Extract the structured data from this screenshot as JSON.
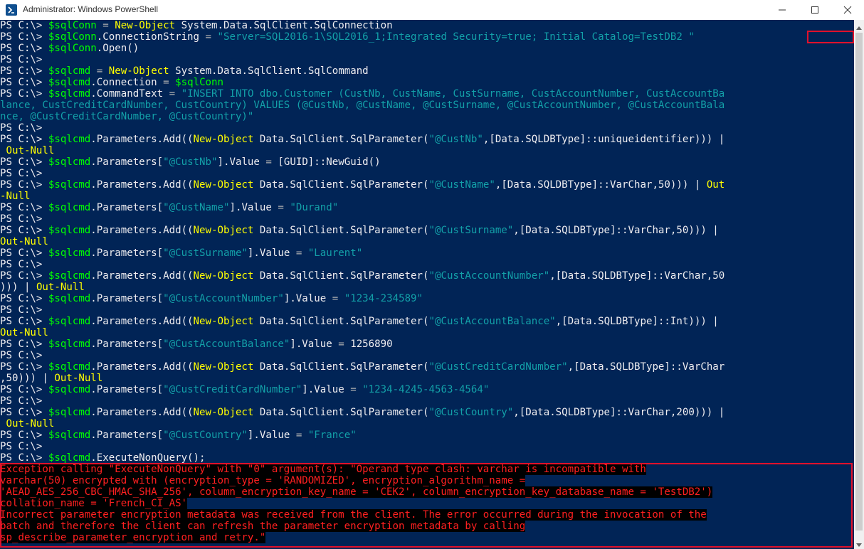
{
  "window": {
    "title": "Administrator: Windows PowerShell",
    "icons": {
      "app": "powershell-icon",
      "minimize": "minimize-icon",
      "maximize": "maximize-icon",
      "close": "close-icon"
    },
    "colors": {
      "console_bg": "#012456",
      "default_text": "#eeedf0",
      "variable": "#00ff00",
      "command": "#ffff00",
      "string": "#13a0a8",
      "error_text": "#ff2020",
      "error_bg": "#000000",
      "highlight_border": "#e0112b"
    }
  },
  "console": {
    "lines": [
      [
        [
          "prompt",
          "PS C:\\> "
        ],
        [
          "var",
          "$sqlConn"
        ],
        [
          "text",
          " "
        ],
        [
          "op",
          "="
        ],
        [
          "text",
          " "
        ],
        [
          "cmd",
          "New-Object"
        ],
        [
          "text",
          " System.Data.SqlClient.SqlConnection"
        ]
      ],
      [
        [
          "prompt",
          "PS C:\\> "
        ],
        [
          "var",
          "$sqlConn"
        ],
        [
          "text",
          ".ConnectionString "
        ],
        [
          "op",
          "="
        ],
        [
          "text",
          " "
        ],
        [
          "str",
          "\"Server=SQL2016-1\\SQL2016_1;Integrated Security=true; Initial Catalog=TestDB2 \""
        ]
      ],
      [
        [
          "prompt",
          "PS C:\\> "
        ],
        [
          "var",
          "$sqlConn"
        ],
        [
          "text",
          ".Open()"
        ]
      ],
      [
        [
          "prompt",
          "PS C:\\>"
        ]
      ],
      [
        [
          "prompt",
          "PS C:\\> "
        ],
        [
          "var",
          "$sqlcmd"
        ],
        [
          "text",
          " "
        ],
        [
          "op",
          "="
        ],
        [
          "text",
          " "
        ],
        [
          "cmd",
          "New-Object"
        ],
        [
          "text",
          " System.Data.SqlClient.SqlCommand"
        ]
      ],
      [
        [
          "prompt",
          "PS C:\\> "
        ],
        [
          "var",
          "$sqlcmd"
        ],
        [
          "text",
          ".Connection "
        ],
        [
          "op",
          "="
        ],
        [
          "text",
          " "
        ],
        [
          "var",
          "$sqlConn"
        ]
      ],
      [
        [
          "prompt",
          "PS C:\\> "
        ],
        [
          "var",
          "$sqlcmd"
        ],
        [
          "text",
          ".CommandText "
        ],
        [
          "op",
          "="
        ],
        [
          "text",
          " "
        ],
        [
          "str",
          "\"INSERT INTO dbo.Customer (CustNb, CustName, CustSurname, CustAccountNumber, CustAccountBa"
        ]
      ],
      [
        [
          "str",
          "lance, CustCreditCardNumber, CustCountry) VALUES (@CustNb, @CustName, @CustSurname, @CustAccountNumber, @CustAccountBala"
        ]
      ],
      [
        [
          "str",
          "nce, @CustCreditCardNumber, @CustCountry)\""
        ]
      ],
      [
        [
          "prompt",
          "PS C:\\>"
        ]
      ],
      [
        [
          "prompt",
          "PS C:\\> "
        ],
        [
          "var",
          "$sqlcmd"
        ],
        [
          "text",
          ".Parameters.Add(("
        ],
        [
          "cmd",
          "New-Object"
        ],
        [
          "text",
          " Data.SqlClient.SqlParameter("
        ],
        [
          "str",
          "\"@CustNb\""
        ],
        [
          "text",
          ",[Data.SQLDBType]::uniqueidentifier))) |"
        ]
      ],
      [
        [
          "text",
          " "
        ],
        [
          "cmd",
          "Out-Null"
        ]
      ],
      [
        [
          "prompt",
          "PS C:\\> "
        ],
        [
          "var",
          "$sqlcmd"
        ],
        [
          "text",
          ".Parameters["
        ],
        [
          "str",
          "\"@CustNb\""
        ],
        [
          "text",
          "].Value "
        ],
        [
          "op",
          "="
        ],
        [
          "text",
          " [GUID]::NewGuid()"
        ]
      ],
      [
        [
          "prompt",
          "PS C:\\>"
        ]
      ],
      [
        [
          "prompt",
          "PS C:\\> "
        ],
        [
          "var",
          "$sqlcmd"
        ],
        [
          "text",
          ".Parameters.Add(("
        ],
        [
          "cmd",
          "New-Object"
        ],
        [
          "text",
          " Data.SqlClient.SqlParameter("
        ],
        [
          "str",
          "\"@CustName\""
        ],
        [
          "text",
          ",[Data.SQLDBType]::VarChar,50))) | "
        ],
        [
          "cmd",
          "Out"
        ]
      ],
      [
        [
          "cmd",
          "-Null"
        ]
      ],
      [
        [
          "prompt",
          "PS C:\\> "
        ],
        [
          "var",
          "$sqlcmd"
        ],
        [
          "text",
          ".Parameters["
        ],
        [
          "str",
          "\"@CustName\""
        ],
        [
          "text",
          "].Value "
        ],
        [
          "op",
          "="
        ],
        [
          "text",
          " "
        ],
        [
          "str",
          "\"Durand\""
        ]
      ],
      [
        [
          "prompt",
          "PS C:\\>"
        ]
      ],
      [
        [
          "prompt",
          "PS C:\\> "
        ],
        [
          "var",
          "$sqlcmd"
        ],
        [
          "text",
          ".Parameters.Add(("
        ],
        [
          "cmd",
          "New-Object"
        ],
        [
          "text",
          " Data.SqlClient.SqlParameter("
        ],
        [
          "str",
          "\"@CustSurname\""
        ],
        [
          "text",
          ",[Data.SQLDBType]::VarChar,50))) |"
        ]
      ],
      [
        [
          "cmd",
          "Out-Null"
        ]
      ],
      [
        [
          "prompt",
          "PS C:\\> "
        ],
        [
          "var",
          "$sqlcmd"
        ],
        [
          "text",
          ".Parameters["
        ],
        [
          "str",
          "\"@CustSurname\""
        ],
        [
          "text",
          "].Value "
        ],
        [
          "op",
          "="
        ],
        [
          "text",
          " "
        ],
        [
          "str",
          "\"Laurent\""
        ]
      ],
      [
        [
          "prompt",
          "PS C:\\>"
        ]
      ],
      [
        [
          "prompt",
          "PS C:\\> "
        ],
        [
          "var",
          "$sqlcmd"
        ],
        [
          "text",
          ".Parameters.Add(("
        ],
        [
          "cmd",
          "New-Object"
        ],
        [
          "text",
          " Data.SqlClient.SqlParameter("
        ],
        [
          "str",
          "\"@CustAccountNumber\""
        ],
        [
          "text",
          ",[Data.SQLDBType]::VarChar,50"
        ]
      ],
      [
        [
          "text",
          ")))"
        ],
        [
          "text",
          " | "
        ],
        [
          "cmd",
          "Out-Null"
        ]
      ],
      [
        [
          "prompt",
          "PS C:\\> "
        ],
        [
          "var",
          "$sqlcmd"
        ],
        [
          "text",
          ".Parameters["
        ],
        [
          "str",
          "\"@CustAccountNumber\""
        ],
        [
          "text",
          "].Value "
        ],
        [
          "op",
          "="
        ],
        [
          "text",
          " "
        ],
        [
          "str",
          "\"1234-234589\""
        ]
      ],
      [
        [
          "prompt",
          "PS C:\\>"
        ]
      ],
      [
        [
          "prompt",
          "PS C:\\> "
        ],
        [
          "var",
          "$sqlcmd"
        ],
        [
          "text",
          ".Parameters.Add(("
        ],
        [
          "cmd",
          "New-Object"
        ],
        [
          "text",
          " Data.SqlClient.SqlParameter("
        ],
        [
          "str",
          "\"@CustAccountBalance\""
        ],
        [
          "text",
          ",[Data.SQLDBType]::Int))) |"
        ]
      ],
      [
        [
          "cmd",
          "Out-Null"
        ]
      ],
      [
        [
          "prompt",
          "PS C:\\> "
        ],
        [
          "var",
          "$sqlcmd"
        ],
        [
          "text",
          ".Parameters["
        ],
        [
          "str",
          "\"@CustAccountBalance\""
        ],
        [
          "text",
          "].Value "
        ],
        [
          "op",
          "="
        ],
        [
          "text",
          " 1256890"
        ]
      ],
      [
        [
          "prompt",
          "PS C:\\>"
        ]
      ],
      [
        [
          "prompt",
          "PS C:\\> "
        ],
        [
          "var",
          "$sqlcmd"
        ],
        [
          "text",
          ".Parameters.Add(("
        ],
        [
          "cmd",
          "New-Object"
        ],
        [
          "text",
          " Data.SqlClient.SqlParameter("
        ],
        [
          "str",
          "\"@CustCreditCardNumber\""
        ],
        [
          "text",
          ",[Data.SQLDBType]::VarChar"
        ]
      ],
      [
        [
          "text",
          ",50)))"
        ],
        [
          "text",
          " | "
        ],
        [
          "cmd",
          "Out-Null"
        ]
      ],
      [
        [
          "prompt",
          "PS C:\\> "
        ],
        [
          "var",
          "$sqlcmd"
        ],
        [
          "text",
          ".Parameters["
        ],
        [
          "str",
          "\"@CustCreditCardNumber\""
        ],
        [
          "text",
          "].Value "
        ],
        [
          "op",
          "="
        ],
        [
          "text",
          " "
        ],
        [
          "str",
          "\"1234-4245-4563-4564\""
        ]
      ],
      [
        [
          "prompt",
          "PS C:\\>"
        ]
      ],
      [
        [
          "prompt",
          "PS C:\\> "
        ],
        [
          "var",
          "$sqlcmd"
        ],
        [
          "text",
          ".Parameters.Add(("
        ],
        [
          "cmd",
          "New-Object"
        ],
        [
          "text",
          " Data.SqlClient.SqlParameter("
        ],
        [
          "str",
          "\"@CustCountry\""
        ],
        [
          "text",
          ",[Data.SQLDBType]::VarChar,200))) |"
        ]
      ],
      [
        [
          "text",
          " "
        ],
        [
          "cmd",
          "Out-Null"
        ]
      ],
      [
        [
          "prompt",
          "PS C:\\> "
        ],
        [
          "var",
          "$sqlcmd"
        ],
        [
          "text",
          ".Parameters["
        ],
        [
          "str",
          "\"@CustCountry\""
        ],
        [
          "text",
          "].Value "
        ],
        [
          "op",
          "="
        ],
        [
          "text",
          " "
        ],
        [
          "str",
          "\"France\""
        ]
      ],
      [
        [
          "prompt",
          "PS C:\\>"
        ]
      ],
      [
        [
          "prompt",
          "PS C:\\> "
        ],
        [
          "var",
          "$sqlcmd"
        ],
        [
          "text",
          ".ExecuteNonQuery();"
        ]
      ],
      [
        [
          "err",
          "Exception calling \"ExecuteNonQuery\" with \"0\" argument(s): \"Operand type clash: varchar is incompatible with"
        ]
      ],
      [
        [
          "err",
          "varchar(50) encrypted with (encryption_type = 'RANDOMIZED', encryption_algorithm_name ="
        ]
      ],
      [
        [
          "err",
          "'AEAD_AES_256_CBC_HMAC_SHA_256', column_encryption_key_name = 'CEK2', column_encryption_key_database_name = 'TestDB2')"
        ]
      ],
      [
        [
          "err",
          "collation_name = 'French_CI_AS'"
        ]
      ],
      [
        [
          "err",
          "Incorrect parameter encryption metadata was received from the client. The error occurred during the invocation of the"
        ]
      ],
      [
        [
          "err",
          "batch and therefore the client can refresh the parameter encryption metadata by calling"
        ]
      ],
      [
        [
          "err",
          "sp_describe_parameter_encryption and retry.\""
        ]
      ]
    ]
  }
}
